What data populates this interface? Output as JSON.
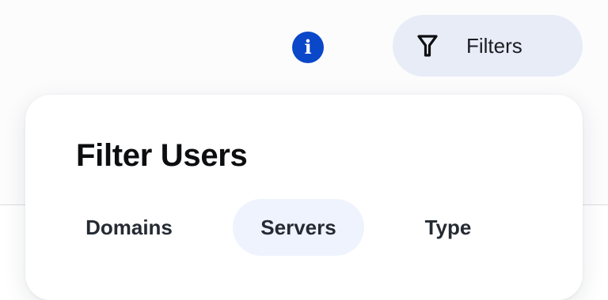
{
  "header": {
    "info_glyph": "i",
    "filters_label": "Filters"
  },
  "filter_panel": {
    "title": "Filter Users",
    "tabs": [
      {
        "label": "Domains",
        "selected": false
      },
      {
        "label": "Servers",
        "selected": true
      },
      {
        "label": "Type",
        "selected": false
      }
    ]
  },
  "colors": {
    "info_button": "#0a47c9",
    "filters_button_bg": "#e7ecf7",
    "selected_tab_bg": "#eef3fd",
    "title_text": "#0d0e10"
  },
  "icons": {
    "info": "info-icon",
    "filters": "filter-funnel-icon"
  }
}
